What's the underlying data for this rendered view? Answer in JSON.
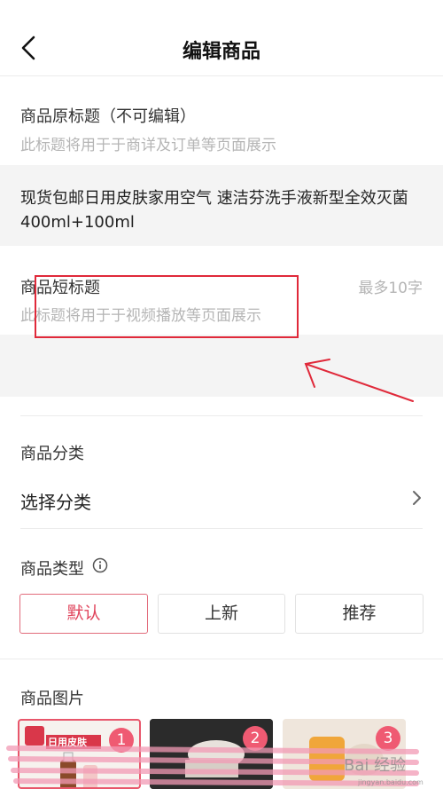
{
  "header": {
    "title": "编辑商品"
  },
  "original_title": {
    "label": "商品原标题（不可编辑）",
    "hint": "此标题将用于于商详及订单等页面展示",
    "value": "现货包邮日用皮肤家用空气 速洁芬洗手液新型全效灭菌400ml+100ml"
  },
  "short_title": {
    "label": "商品短标题",
    "limit": "最多10字",
    "hint": "此标题将用于于视频播放等页面展示",
    "value": ""
  },
  "category": {
    "label": "商品分类",
    "select_text": "选择分类"
  },
  "product_type": {
    "label": "商品类型",
    "options": [
      "默认",
      "上新",
      "推荐"
    ],
    "selected": "默认"
  },
  "images": {
    "label": "商品图片",
    "items": [
      {
        "index": "1",
        "caption": "日用皮肤"
      },
      {
        "index": "2"
      },
      {
        "index": "3"
      }
    ]
  },
  "watermark": {
    "text": "Bai 经验",
    "sub": "jingyan.baidu.com"
  },
  "colors": {
    "accent": "#e0445c",
    "annotation_red": "#e0293a"
  }
}
